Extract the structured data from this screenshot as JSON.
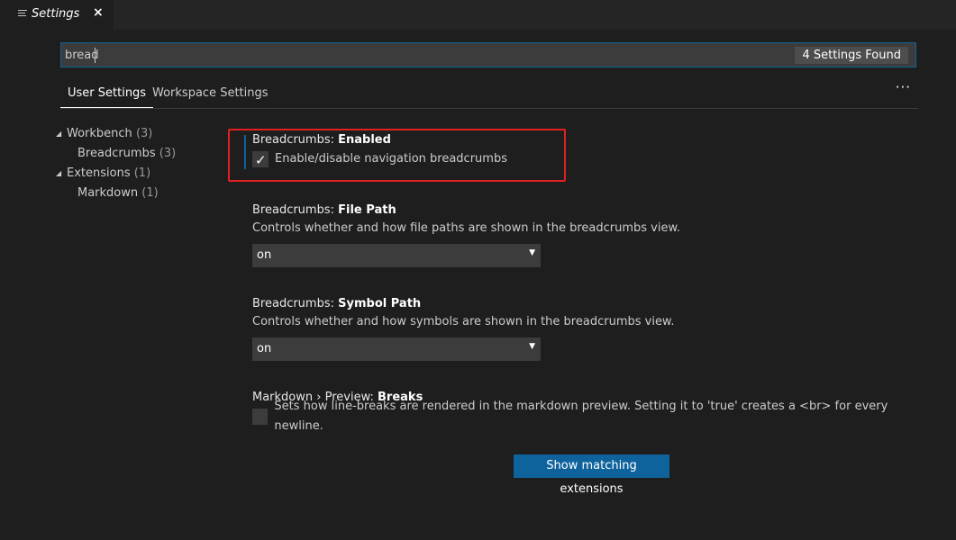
{
  "tab": {
    "title": "Settings",
    "close": "×",
    "icon": "list-icon"
  },
  "search": {
    "value": "bread",
    "results": "4 Settings Found"
  },
  "settings_tabs": {
    "user": "User Settings",
    "workspace": "Workspace Settings",
    "more": "···"
  },
  "tree": [
    {
      "label": "Workbench",
      "count": "(3)",
      "expanded": true
    },
    {
      "label": "Breadcrumbs",
      "count": "(3)"
    },
    {
      "label": "Extensions",
      "count": "(1)",
      "expanded": true
    },
    {
      "label": "Markdown",
      "count": "(1)"
    }
  ],
  "settings": {
    "enabled": {
      "prefix": "Breadcrumbs: ",
      "name": "Enabled",
      "desc": "Enable/disable navigation breadcrumbs",
      "checked": true
    },
    "file_path": {
      "prefix": "Breadcrumbs: ",
      "name": "File Path",
      "desc": "Controls whether and how file paths are shown in the breadcrumbs view.",
      "value": "on"
    },
    "symbol_path": {
      "prefix": "Breadcrumbs: ",
      "name": "Symbol Path",
      "desc": "Controls whether and how symbols are shown in the breadcrumbs view.",
      "value": "on"
    },
    "breaks": {
      "prefix": "Markdown › Preview: ",
      "name": "Breaks",
      "desc": "Sets how line-breaks are rendered in the markdown preview. Setting it to 'true' creates a <br> for every newline.",
      "checked": false
    }
  },
  "extensions_button": "Show matching extensions",
  "colors": {
    "accent": "#0e639c",
    "highlight": "#e02020",
    "background": "#1e1e1e"
  }
}
